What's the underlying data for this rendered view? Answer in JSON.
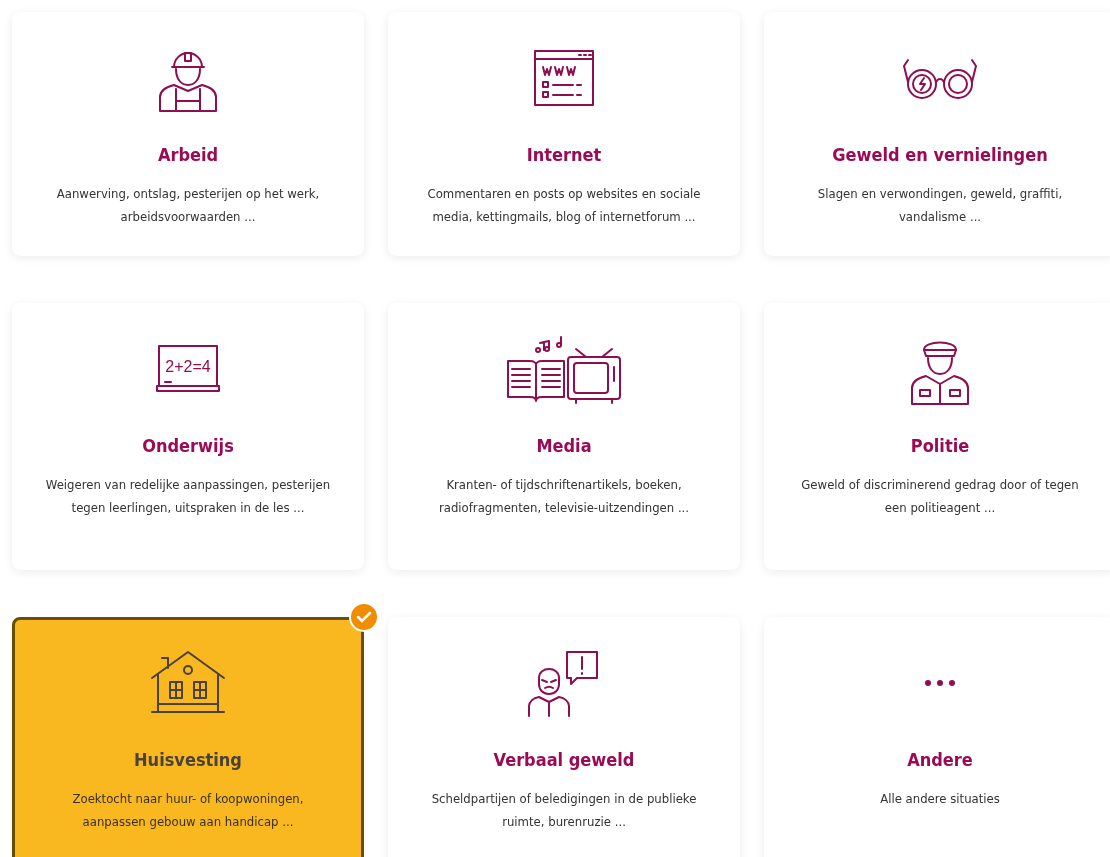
{
  "cards": [
    {
      "title": "Arbeid",
      "description": "Aanwerving, ontslag, pesterijen op het werk, arbeidsvoorwaarden ...",
      "selected": false
    },
    {
      "title": "Internet",
      "description": "Commentaren en posts op websites en sociale media, kettingmails, blog of internetforum ...",
      "selected": false
    },
    {
      "title": "Geweld en vernielingen",
      "description": "Slagen en verwondingen, geweld, graffiti, vandalisme ...",
      "selected": false
    },
    {
      "icon_text": "2+2=4",
      "title": "Onderwijs",
      "description": "Weigeren van redelijke aanpassingen, pesterijen tegen leerlingen, uitspraken in de les ...",
      "selected": false
    },
    {
      "title": "Media",
      "description": "Kranten- of tijdschriftenartikels, boeken, radiofragmenten, televisie-uitzendingen ...",
      "selected": false
    },
    {
      "title": "Politie",
      "description": "Geweld of discriminerend gedrag door of tegen een politieagent ...",
      "selected": false
    },
    {
      "title": "Huisvesting",
      "description": "Zoektocht naar huur- of koopwoningen, aanpassen gebouw aan handicap ...",
      "selected": true
    },
    {
      "title": "Verbaal geweld",
      "description": "Scheldpartijen of beledigingen in de publieke ruimte, burenruzie ...",
      "selected": false
    },
    {
      "title": "Andere",
      "description": "Alle andere situaties",
      "selected": false
    }
  ]
}
